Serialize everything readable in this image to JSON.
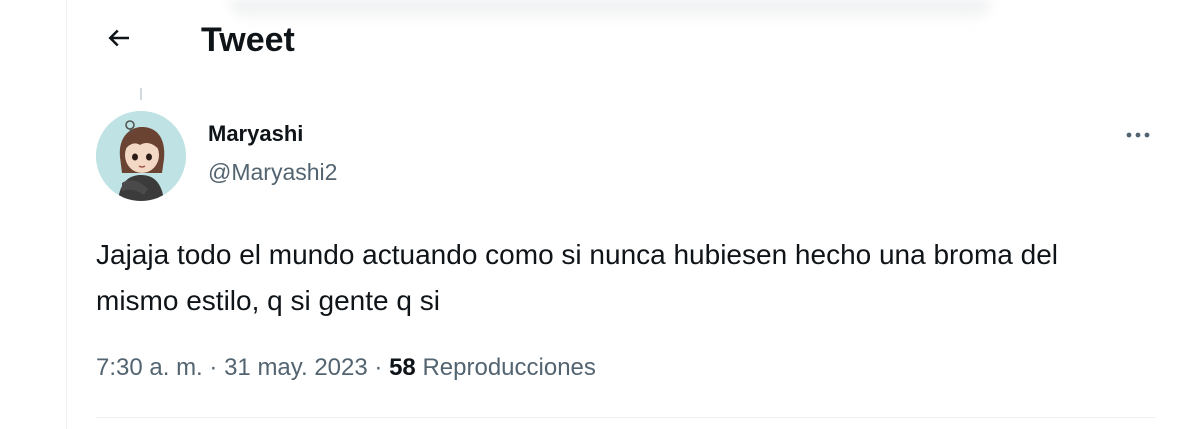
{
  "header": {
    "back_icon": "arrow-left-icon",
    "title": "Tweet"
  },
  "tweet": {
    "author": {
      "display_name": "Maryashi",
      "handle": "@Maryashi2",
      "avatar_icon": "avatar-illustration"
    },
    "more_icon": "more-horizontal-icon",
    "text": "Jajaja todo el mundo actuando como si nunca hubiesen hecho una broma del mismo estilo, q si gente q si",
    "time": "7:30 a. m.",
    "separator": "·",
    "date": "31 may. 2023",
    "views_count": "58",
    "views_label": "Reproducciones"
  },
  "colors": {
    "text_primary": "#0f1419",
    "text_secondary": "#536471",
    "avatar_bg": "#bfe3e4",
    "border": "#eff3f4"
  }
}
